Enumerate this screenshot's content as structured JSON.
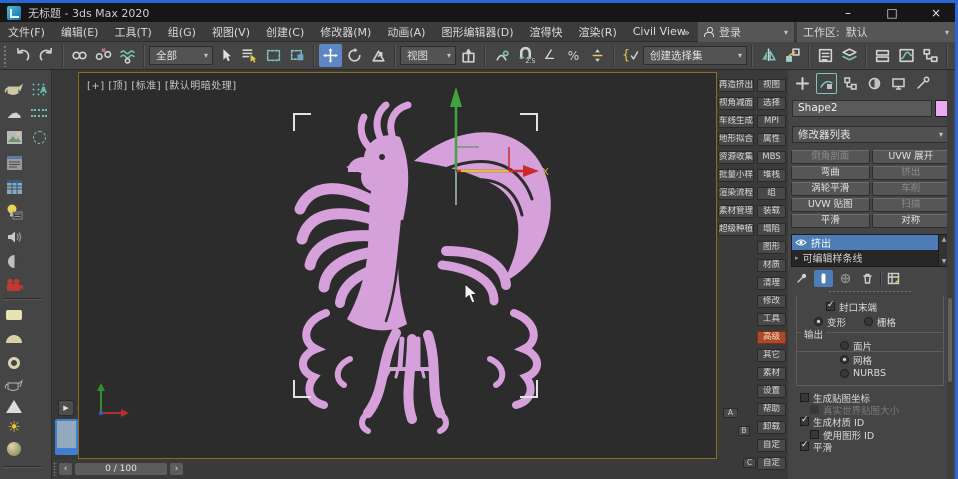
{
  "window": {
    "title": "无标题 - 3ds Max 2020",
    "minimize": "–",
    "maximize": "□",
    "close": "×"
  },
  "menubar": {
    "items": [
      "文件(F)",
      "编辑(E)",
      "工具(T)",
      "组(G)",
      "视图(V)",
      "创建(C)",
      "修改器(M)",
      "动画(A)",
      "图形编辑器(D)",
      "渲得快",
      "渲染(R)",
      "Civil View"
    ],
    "overflow": "»",
    "login_label": "登录",
    "workspace_label": "工作区:",
    "workspace_value": "默认",
    "dropdown_arrow": "▾"
  },
  "toolbar": {
    "selection_filter": "全部",
    "reference_coord": "视图",
    "named_sets": "创建选择集",
    "snap_label": "2.5",
    "angle_glyph": "∠",
    "percent_glyph": "%",
    "sets_glyph": "{"
  },
  "viewport": {
    "label": "[+] [顶] [标准] [默认明暗处理]",
    "axis_x_label": "X"
  },
  "timeline": {
    "value": "0 / 100",
    "prev": "‹",
    "next": "›"
  },
  "gutter": {
    "expand_arrow": "▶"
  },
  "quad_panel": {
    "left_buttons": [
      "再造挤出",
      "视角减面",
      "车线生成",
      "地形拟合",
      "资源收集",
      "批量小样",
      "渲染流程",
      "素材管理",
      "超级种植"
    ],
    "right_buttons": [
      {
        "label": "视图"
      },
      {
        "label": "选择"
      },
      {
        "label": "MPI"
      },
      {
        "label": "属性"
      },
      {
        "label": "MBS"
      },
      {
        "label": "堆栈"
      },
      {
        "label": "组"
      },
      {
        "label": "装载"
      },
      {
        "label": "塌陷"
      },
      {
        "label": "图形"
      },
      {
        "label": "材质"
      },
      {
        "label": "清理"
      },
      {
        "label": "修改"
      },
      {
        "label": "工具"
      },
      {
        "label": "高级",
        "active": true
      },
      {
        "label": "其它"
      },
      {
        "label": "素材"
      },
      {
        "label": "设置"
      },
      {
        "label": "帮助"
      },
      {
        "label": "卸载"
      },
      {
        "label": "自定"
      },
      {
        "label": "自定"
      }
    ],
    "tag_a": "A",
    "tag_b": "B",
    "tag_c": "C"
  },
  "command_panel": {
    "object_name": "Shape2",
    "object_color": "#ebaaf2",
    "modifier_list_label": "修改器列表",
    "modifier_buttons": [
      {
        "label": "倒角剖面",
        "dim": true
      },
      {
        "label": "UVW 展开"
      },
      {
        "label": "弯曲"
      },
      {
        "label": "挤出",
        "dim": true
      },
      {
        "label": "涡轮平滑"
      },
      {
        "label": "车削",
        "dim": true
      },
      {
        "label": "UVW 贴图"
      },
      {
        "label": "扫描",
        "dim": true
      },
      {
        "label": "平滑"
      },
      {
        "label": "对称"
      }
    ],
    "stack": {
      "modifier": "挤出",
      "base_object": "可编辑样条线",
      "scroll_up": "▲",
      "scroll_down": "▼"
    },
    "parameters": {
      "cap_end": "封口末端",
      "morph": "变形",
      "grid": "栅格",
      "output_group": "输出",
      "patch": "面片",
      "mesh": "网格",
      "nurbs": "NURBS",
      "gen_mapping": "生成贴图坐标",
      "real_world": "真实世界贴图大小",
      "gen_material_id": "生成材质 ID",
      "use_shape_id": "使用图形 ID",
      "smooth": "平滑"
    }
  },
  "colors": {
    "accent_blue": "#2b66d9",
    "selection_blue": "#4d7db6",
    "active_orange": "#aa4a28",
    "object_pink": "#ebaaf2",
    "artwork_pink": "#d6a0db",
    "viewport_border": "#8a6e20"
  }
}
